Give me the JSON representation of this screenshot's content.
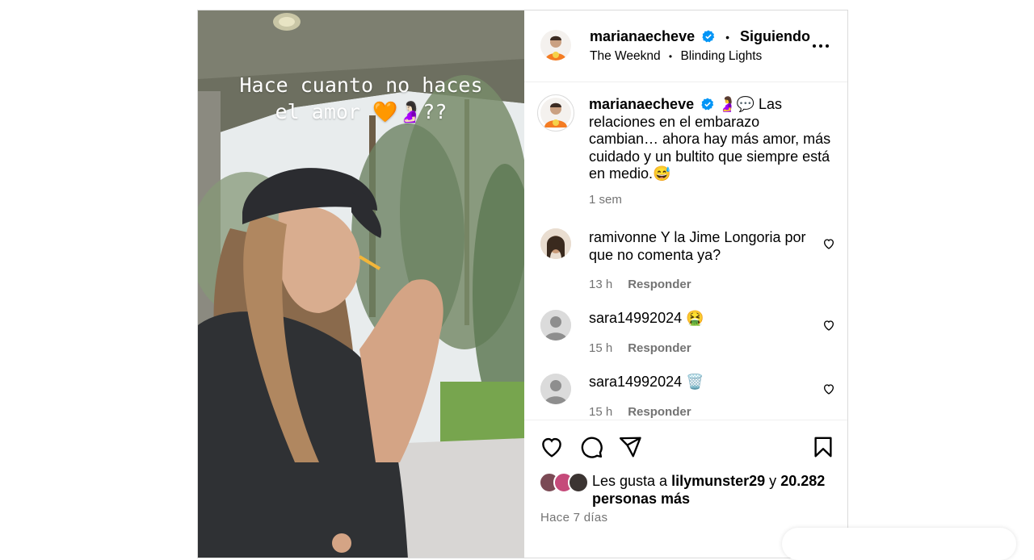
{
  "post": {
    "overlay_lines": [
      "Hace cuanto no haces",
      "el amor 🧡🤰🏻??"
    ],
    "author": {
      "username": "marianaecheve",
      "follow_label": "Siguiendo",
      "audio_artist": "The Weeknd",
      "audio_track": "Blinding Lights"
    },
    "caption": {
      "username": "marianaecheve",
      "text": "🤰💬 Las relaciones en el embarazo cambian… ahora hay más amor, más cuidado y un bultito que siempre está en medio.😅",
      "time": "1 sem"
    },
    "comments": [
      {
        "username": "ramivonne",
        "text": "Y la Jime Longoria por que no comenta ya?",
        "time": "13 h",
        "reply_label": "Responder"
      },
      {
        "username": "sara14992024",
        "text": "🤮",
        "time": "15 h",
        "reply_label": "Responder"
      },
      {
        "username": "sara14992024",
        "text": "🗑️",
        "time": "15 h",
        "reply_label": "Responder"
      }
    ],
    "likes": {
      "prefix": "Les gusta a",
      "user": "lilymunster29",
      "joiner": "y",
      "count": "20.282",
      "suffix": "personas más"
    },
    "posted_ago": "Hace 7 días"
  },
  "colors": {
    "verified": "#0095f6",
    "secondary_text": "#737373",
    "border": "#dbdbdb"
  },
  "icons": [
    "verified-icon",
    "more-options-icon",
    "heart-icon",
    "comment-icon",
    "share-icon",
    "save-icon"
  ]
}
